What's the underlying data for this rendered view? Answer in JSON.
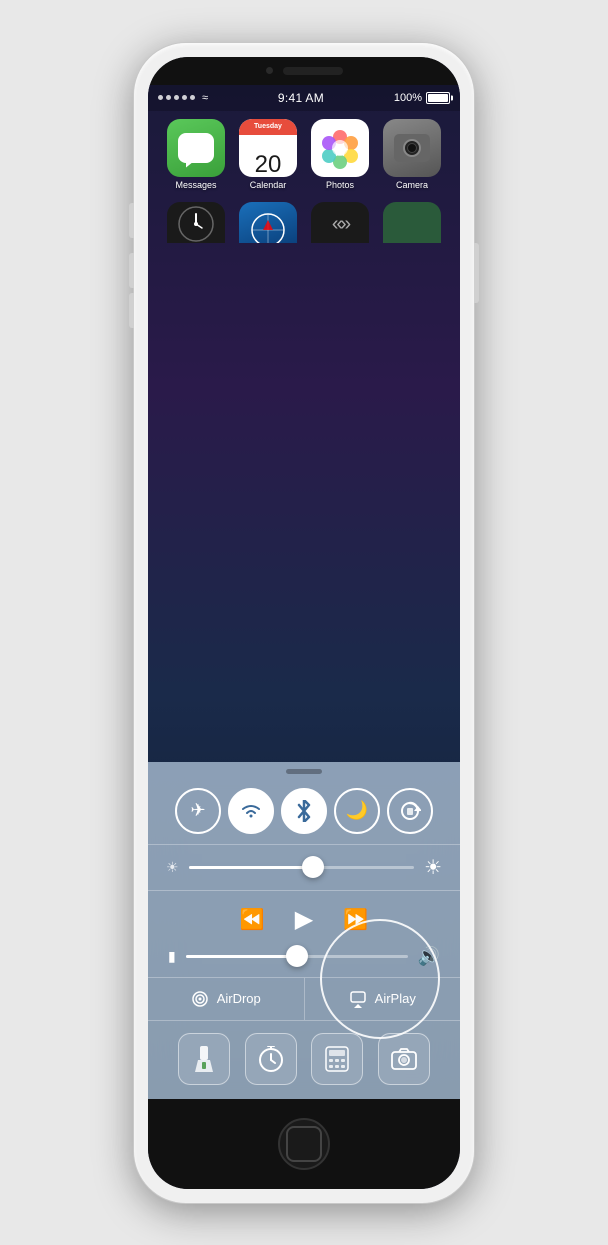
{
  "phone": {
    "status_bar": {
      "time": "9:41 AM",
      "battery": "100%",
      "signal_dots": 5
    },
    "apps_row1": [
      {
        "name": "Messages",
        "type": "messages"
      },
      {
        "name": "Calendar",
        "type": "calendar",
        "day_name": "Tuesday",
        "day_num": "20"
      },
      {
        "name": "Photos",
        "type": "photos"
      },
      {
        "name": "Camera",
        "type": "camera"
      }
    ],
    "control_center": {
      "toggles": [
        {
          "id": "airplane",
          "icon": "✈",
          "label": "Airplane Mode",
          "active": false
        },
        {
          "id": "wifi",
          "icon": "wifi",
          "label": "Wi-Fi",
          "active": true
        },
        {
          "id": "bluetooth",
          "icon": "bt",
          "label": "Bluetooth",
          "active": true
        },
        {
          "id": "donotdisturb",
          "icon": "🌙",
          "label": "Do Not Disturb",
          "active": false
        },
        {
          "id": "rotation",
          "icon": "rotation",
          "label": "Rotation Lock",
          "active": false
        }
      ],
      "brightness_percent": 55,
      "volume_percent": 50,
      "airdrop_label": "AirDrop",
      "airplay_label": "AirPlay",
      "tools": [
        {
          "id": "flashlight",
          "icon": "flashlight",
          "label": "Flashlight"
        },
        {
          "id": "timer",
          "icon": "timer",
          "label": "Timer"
        },
        {
          "id": "calculator",
          "icon": "calculator",
          "label": "Calculator"
        },
        {
          "id": "camera2",
          "icon": "camera",
          "label": "Camera"
        }
      ]
    }
  }
}
